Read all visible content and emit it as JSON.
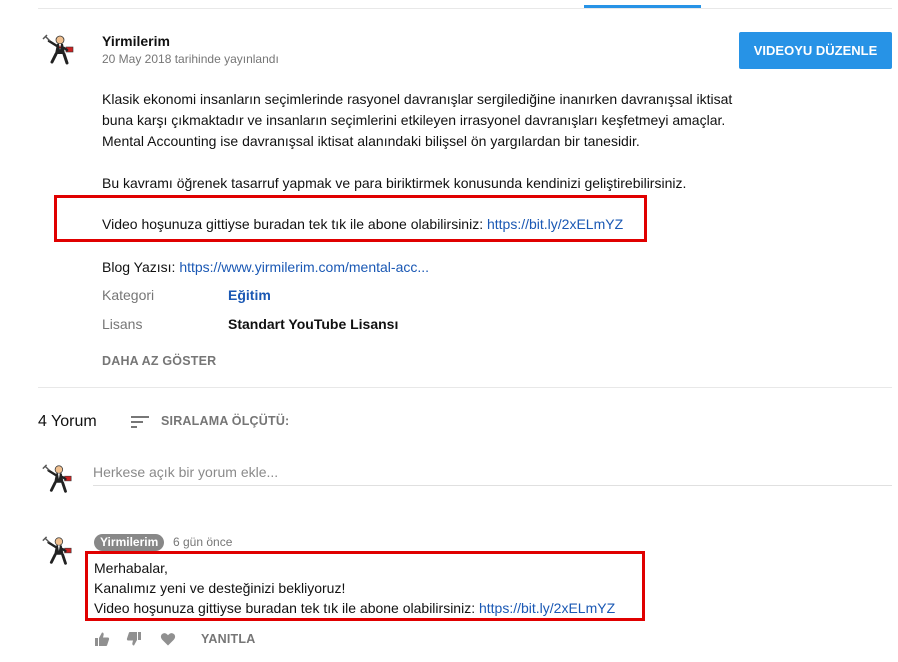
{
  "channel": {
    "name": "Yirmilerim",
    "publish_date": "20 May 2018 tarihinde yayınlandı"
  },
  "edit_button": "VIDEOYU DÜZENLE",
  "description": {
    "paragraph1": "Klasik ekonomi insanların seçimlerinde rasyonel davranışlar sergilediğine inanırken davranışsal iktisat buna karşı çıkmaktadır ve insanların seçimlerini etkileyen irrasyonel davranışları keşfetmeyi amaçlar. Mental Accounting ise davranışsal iktisat alanındaki bilişsel ön yargılardan bir tanesidir.",
    "paragraph2": "Bu kavramı öğrenek tasarruf yapmak ve para biriktirmek konusunda kendinizi geliştirebilirsiniz.",
    "subscribe_text": "Video hoşunuza gittiyse buradan tek tık ile abone olabilirsiniz: ",
    "subscribe_link": "https://bit.ly/2xELmYZ",
    "blog_label": "Blog Yazısı: ",
    "blog_link": "https://www.yirmilerim.com/mental-acc..."
  },
  "metadata": {
    "category_label": "Kategori",
    "category_value": "Eğitim",
    "license_label": "Lisans",
    "license_value": "Standart YouTube Lisansı"
  },
  "show_less": "DAHA AZ GÖSTER",
  "comments": {
    "count_label": "4 Yorum",
    "sort_label": "SIRALAMA ÖLÇÜTÜ:",
    "input_placeholder": "Herkese açık bir yorum ekle...",
    "items": [
      {
        "author": "Yirmilerim",
        "time": "6 gün önce",
        "line1": "Merhabalar,",
        "line2": "Kanalımız yeni ve desteğinizi bekliyoruz!",
        "line3_text": "Video hoşunuza gittiyse buradan tek tık ile abone olabilirsiniz: ",
        "line3_link": "https://bit.ly/2xELmYZ",
        "reply_label": "YANITLA"
      }
    ]
  },
  "colors": {
    "accent": "#2793e6",
    "link": "#1a58b4",
    "highlight": "#e00000"
  },
  "icons": [
    "avatar-icon",
    "sort-icon",
    "like-icon",
    "dislike-icon",
    "heart-icon"
  ]
}
